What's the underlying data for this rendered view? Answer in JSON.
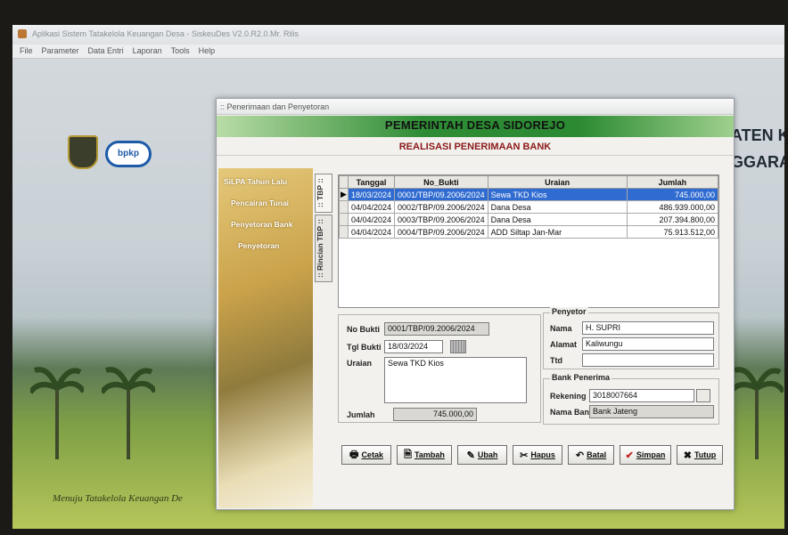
{
  "window": {
    "title": "Aplikasi Sistem Tatakelola Keuangan Desa - SiskeuDes V2.0.R2.0.Mr. Rilis",
    "menu": [
      "File",
      "Parameter",
      "Data Entri",
      "Laporan",
      "Tools",
      "Help"
    ]
  },
  "background": {
    "logo_text": "bpkp",
    "right_text_1": "ATEN K",
    "right_text_2": "GGARAN",
    "tagline": "Menuju Tatakelola Keuangan De"
  },
  "dialog": {
    "title": ":: Penerimaan dan Penyetoran",
    "banner": "PEMERINTAH DESA SIDOREJO",
    "subhead": "REALISASI PENERIMAAN BANK"
  },
  "side_menu": [
    "SiLPA Tahun Lalu",
    "Pencairan Tunai",
    "Penyetoran Bank",
    "Penyetoran"
  ],
  "tabs": [
    ":: TBP ::",
    ":: Rincian TBP ::"
  ],
  "grid": {
    "columns": [
      "Tanggal",
      "No_Bukti",
      "Uraian",
      "Jumlah"
    ],
    "rows": [
      {
        "tanggal": "18/03/2024",
        "no_bukti": "0001/TBP/09.2006/2024",
        "uraian": "Sewa TKD Kios",
        "jumlah": "745.000,00",
        "selected": true
      },
      {
        "tanggal": "04/04/2024",
        "no_bukti": "0002/TBP/09.2006/2024",
        "uraian": "Dana Desa",
        "jumlah": "486.939.000,00",
        "selected": false
      },
      {
        "tanggal": "04/04/2024",
        "no_bukti": "0003/TBP/09.2006/2024",
        "uraian": "Dana Desa",
        "jumlah": "207.394.800,00",
        "selected": false
      },
      {
        "tanggal": "04/04/2024",
        "no_bukti": "0004/TBP/09.2006/2024",
        "uraian": "ADD Siltap Jan-Mar",
        "jumlah": "75.913.512,00",
        "selected": false
      }
    ]
  },
  "form": {
    "no_bukti_label": "No Bukti",
    "no_bukti": "0001/TBP/09.2006/2024",
    "tgl_bukti_label": "Tgl Bukti",
    "tgl_bukti": "18/03/2024",
    "uraian_label": "Uraian",
    "uraian": "Sewa TKD Kios",
    "jumlah_label": "Jumlah",
    "jumlah": "745.000,00"
  },
  "penyetor": {
    "group_title": "Penyetor",
    "nama_label": "Nama",
    "nama": "H. SUPRI",
    "alamat_label": "Alamat",
    "alamat": "Kaliwungu",
    "ttd_label": "Ttd",
    "ttd": ""
  },
  "bank": {
    "group_title": "Bank Penerima",
    "rekening_label": "Rekening",
    "rekening": "3018007664",
    "nama_bank_label": "Nama Bank",
    "nama_bank": "Bank Jateng"
  },
  "buttons": {
    "cetak": "Cetak",
    "tambah": "Tambah",
    "ubah": "Ubah",
    "hapus": "Hapus",
    "batal": "Batal",
    "simpan": "Simpan",
    "tutup": "Tutup"
  },
  "colors": {
    "banner_green": "#2b8a32",
    "selection_blue": "#2f6bd0",
    "subhead_red": "#8b1a1a"
  }
}
